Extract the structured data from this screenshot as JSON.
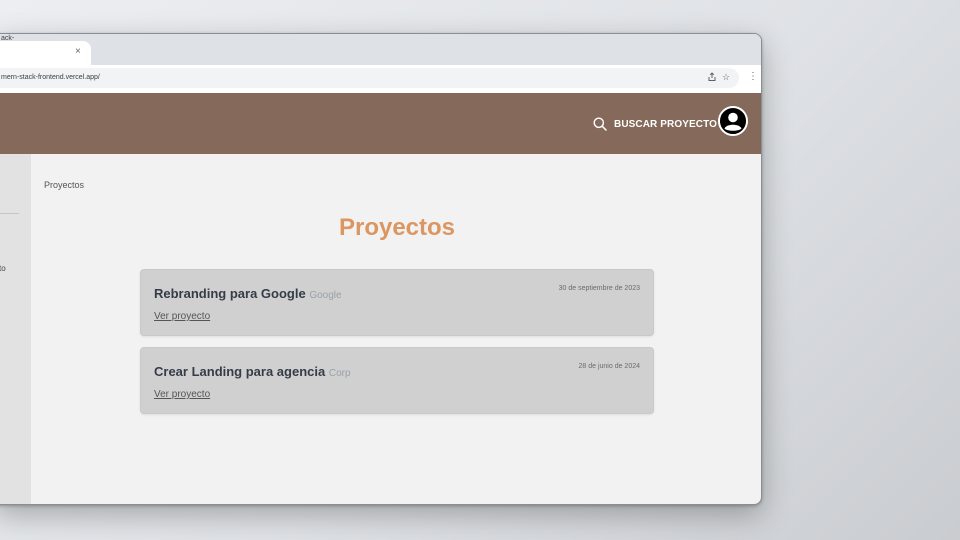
{
  "browser": {
    "tab_title": "ack-",
    "tab_close": "×",
    "url": "mern-stack-frontend.vercel.app/",
    "menu_glyph": "⋮",
    "star_glyph": "☆"
  },
  "header": {
    "search_label": "BUSCAR PROYECTO",
    "icons": [
      "search-icon",
      "user-avatar-icon"
    ],
    "background_color": "#85695a"
  },
  "sidebar": {
    "partial_text": "to"
  },
  "main": {
    "breadcrumb": "Proyectos",
    "title": "Proyectos",
    "title_color": "#db9662",
    "projects": [
      {
        "name": "Rebranding para Google",
        "client": "Google",
        "date": "30 de septiembre de 2023",
        "link": "Ver proyecto"
      },
      {
        "name": "Crear Landing para agencia",
        "client": "Corp",
        "date": "28 de junio de 2024",
        "link": "Ver proyecto"
      }
    ]
  }
}
